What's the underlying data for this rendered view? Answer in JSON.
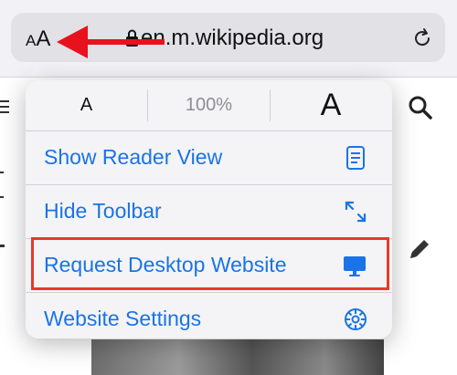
{
  "address_bar": {
    "text_size_small": "A",
    "text_size_large": "A",
    "url": "en.m.wikipedia.org"
  },
  "popup": {
    "font_small_label": "A",
    "zoom_level": "100%",
    "font_large_label": "A",
    "items": [
      {
        "label": "Show Reader View",
        "icon": "reader-view-icon"
      },
      {
        "label": "Hide Toolbar",
        "icon": "expand-arrows-icon"
      },
      {
        "label": "Request Desktop Website",
        "icon": "desktop-monitor-icon"
      },
      {
        "label": "Website Settings",
        "icon": "settings-gear-icon"
      }
    ]
  },
  "colors": {
    "accent": "#1a73e8",
    "annotation_red": "#e8392b",
    "arrow_red": "#e8121f"
  }
}
